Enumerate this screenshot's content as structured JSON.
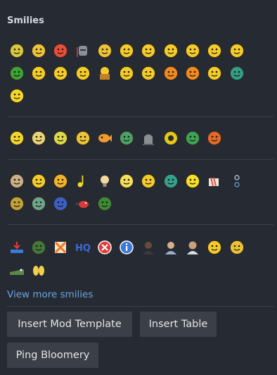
{
  "heading": "Smilies",
  "groups": [
    {
      "rows": [
        [
          "wizard",
          "sleepy",
          "kiss",
          "knight",
          "graduate",
          "cool",
          "confused",
          "surprised",
          "nerd",
          "smile",
          "tongue"
        ],
        [
          "frog",
          "grin",
          "sad",
          "happy",
          "reader",
          "worried",
          "unsure",
          "angry",
          "mad",
          "neutral",
          "teeth"
        ],
        [
          "bee"
        ]
      ]
    },
    {
      "rows": [
        [
          "ghost-bee",
          "meh",
          "nerd-green",
          "nerd-shades",
          "fish",
          "alien-frog",
          "tombstone",
          "donut",
          "sick",
          "pirate"
        ]
      ]
    },
    {
      "rows": [
        [
          "skull",
          "king",
          "hand-point",
          "note",
          "bulb",
          "smile-wide",
          "smirk",
          "teal-face",
          "chick",
          "arm",
          "spark"
        ],
        [
          "elf",
          "blob",
          "blue-face",
          "red-bird",
          "green-face"
        ]
      ]
    },
    {
      "rows": [
        [
          "download",
          "goblin",
          "cross-out",
          "hq",
          "no",
          "info",
          "person-dark",
          "person-fair",
          "person-old",
          "blush",
          "bird-yellow"
        ],
        [
          "crocodile",
          "hands"
        ]
      ]
    }
  ],
  "icons": {
    "wizard": "#d8c840",
    "sleepy": "#e9c43a",
    "kiss": "#e84c3c",
    "knight": "#8a8f98",
    "graduate": "#e9c43a",
    "cool": "#f2cc2b",
    "confused": "#f2cc2b",
    "surprised": "#f2cc2b",
    "nerd": "#f2cc2b",
    "smile": "#f2cc2b",
    "tongue": "#f2cc2b",
    "frog": "#3aa33a",
    "grin": "#f2cc2b",
    "sad": "#f2cc2b",
    "happy": "#f2cc2b",
    "reader": "#c0802a",
    "worried": "#f2cc2b",
    "unsure": "#f2cc2b",
    "angry": "#f08a20",
    "mad": "#f08a20",
    "neutral": "#f2cc2b",
    "teeth": "#2f9f8a",
    "bee": "#f2d72b",
    "ghost-bee": "#f2d72b",
    "meh": "#e7d47a",
    "nerd-green": "#d9d94a",
    "nerd-shades": "#e9c43a",
    "fish": "#f29b2b",
    "alien-frog": "#49a16b",
    "tombstone": "#8b8f94",
    "donut": "#e5c80f",
    "sick": "#3aa35a",
    "pirate": "#e36a2a",
    "skull": "#c9b089",
    "king": "#f2cc2b",
    "hand-point": "#f0b42a",
    "note": "#f2d72b",
    "bulb": "#f2d7a0",
    "smile-wide": "#f2df5b",
    "smirk": "#f2cc2b",
    "teal-face": "#2fa38f",
    "chick": "#f2e12b",
    "arm": "#d9584a",
    "spark": "#d0d4de",
    "elf": "#c0a23a",
    "blob": "#6aa78e",
    "blue-face": "#3b5fd0",
    "red-bird": "#d83a3a",
    "green-face": "#3a8a3a",
    "download": "#3a7ad8",
    "goblin": "#3f7a3f",
    "cross-out": "#e9772b",
    "hq": "#3b6bd8",
    "no": "#e03a3a",
    "info": "#3a7ad8",
    "person-dark": "#6a4a3a",
    "person-fair": "#d8b08a",
    "person-old": "#c9a27a",
    "blush": "#f2cc2b",
    "bird-yellow": "#e9c43a",
    "crocodile": "#5a8a4a",
    "hands": "#f2d04a"
  },
  "hq_text": "HQ",
  "view_more": "View more smilies",
  "buttons": {
    "insert_mod_template": "Insert Mod Template",
    "insert_table": "Insert Table",
    "ping_bloomery": "Ping Bloomery"
  }
}
